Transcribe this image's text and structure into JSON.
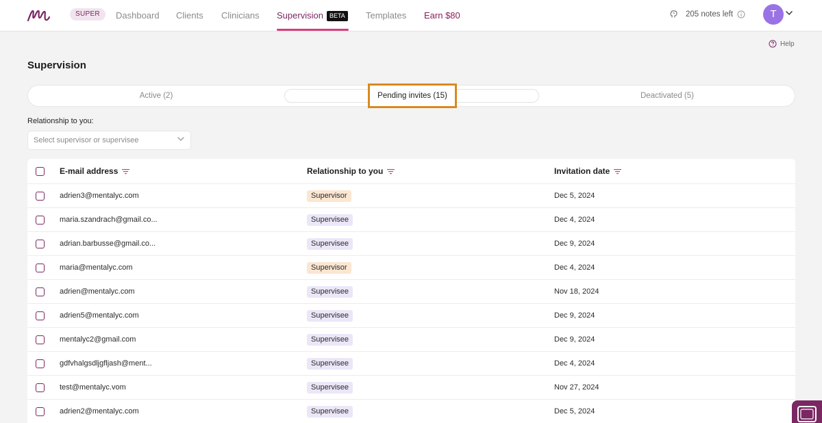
{
  "topnav": {
    "badge": "SUPER",
    "items": [
      {
        "label": "Dashboard"
      },
      {
        "label": "Clients"
      },
      {
        "label": "Clinicians"
      },
      {
        "label": "Supervision",
        "badge": "BETA"
      },
      {
        "label": "Templates"
      },
      {
        "label": "Earn $80"
      }
    ],
    "notes_left": "205 notes left",
    "avatar_initial": "T"
  },
  "header": {
    "help": "Help",
    "title": "Supervision"
  },
  "tabs": [
    {
      "label": "Active (2)"
    },
    {
      "label": "Pending invites (15)",
      "selected": true
    },
    {
      "label": "Deactivated (5)"
    }
  ],
  "filter": {
    "label": "Relationship to you:",
    "placeholder": "Select supervisor or supervisee"
  },
  "table": {
    "columns": [
      "E-mail address",
      "Relationship to you",
      "Invitation date"
    ],
    "rows": [
      {
        "email": "adrien3@mentalyc.com",
        "relationship": "Supervisor",
        "date": "Dec 5, 2024"
      },
      {
        "email": "maria.szandrach@gmail.co...",
        "relationship": "Supervisee",
        "date": "Dec 4, 2024"
      },
      {
        "email": "adrian.barbusse@gmail.co...",
        "relationship": "Supervisee",
        "date": "Dec 9, 2024"
      },
      {
        "email": "maria@mentalyc.com",
        "relationship": "Supervisor",
        "date": "Dec 4, 2024"
      },
      {
        "email": "adrien@mentalyc.com",
        "relationship": "Supervisee",
        "date": "Nov 18, 2024"
      },
      {
        "email": "adrien5@mentalyc.com",
        "relationship": "Supervisee",
        "date": "Dec 9, 2024"
      },
      {
        "email": "mentalyc2@gmail.com",
        "relationship": "Supervisee",
        "date": "Dec 9, 2024"
      },
      {
        "email": "gdfvhalgsdljgfljash@ment...",
        "relationship": "Supervisee",
        "date": "Dec 4, 2024"
      },
      {
        "email": "test@mentalyc.vom",
        "relationship": "Supervisee",
        "date": "Nov 27, 2024"
      },
      {
        "email": "adrien2@mentalyc.com",
        "relationship": "Supervisee",
        "date": "Dec 5, 2024"
      }
    ]
  },
  "colors": {
    "brand": "#7a2763",
    "nav_underline": "#d63c7c",
    "highlight_box": "#d78a1e",
    "supervisor_tag": "#fbe6d2",
    "supervisee_tag": "#ebe7f8",
    "avatar": "#9a72e6"
  }
}
